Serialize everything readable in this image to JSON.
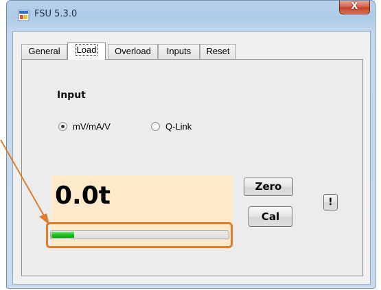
{
  "window": {
    "title": "FSU 5.3.0",
    "close_label": "X"
  },
  "tabs": [
    {
      "label": "General",
      "active": false
    },
    {
      "label": "Load",
      "active": true
    },
    {
      "label": "Overload",
      "active": false
    },
    {
      "label": "Inputs",
      "active": false
    },
    {
      "label": "Reset",
      "active": false
    }
  ],
  "input_group": {
    "label": "Input",
    "options": [
      {
        "label": "mV/mA/V",
        "checked": true
      },
      {
        "label": "Q-Link",
        "checked": false
      }
    ]
  },
  "display": {
    "value": "0.0t",
    "progress": 0.13,
    "progress_color": "#19c21a",
    "background_color": "#ffe9cb"
  },
  "buttons": {
    "zero_label": "Zero",
    "cal_label": "Cal",
    "info_label": "!"
  },
  "annotation": {
    "color": "#e07b2c"
  }
}
